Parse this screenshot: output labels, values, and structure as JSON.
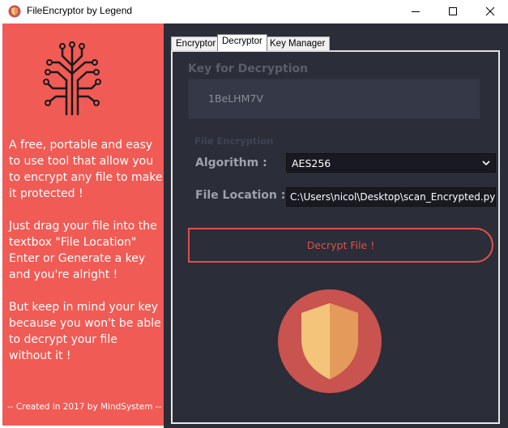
{
  "window": {
    "title": "FileEncryptor by Legend",
    "icons": {
      "app": "shield-app-icon",
      "minimize": "minimize-icon",
      "maximize": "maximize-icon",
      "close": "close-icon"
    }
  },
  "sidebar": {
    "logo_icon": "circuit-tree-icon",
    "paragraphs": [
      "A free, portable and easy to use tool that allow you to encrypt any file to make it protected !",
      "Just drag your file into the textbox \"File Location\" Enter or Generate a key and you're alright !",
      "But keep in mind your key because you won't be able to decrypt your file without it !"
    ],
    "footer": "-- Created in 2017 by MindSystem --"
  },
  "tabs": [
    {
      "label": "Encryptor",
      "active": false
    },
    {
      "label": "Decryptor",
      "active": true
    },
    {
      "label": "Key Manager",
      "active": false
    }
  ],
  "decryptor": {
    "key_title": "Key for Decryption",
    "key_value": "1BeLHM7V",
    "section_title": "File Encryption",
    "algorithm_label": "Algorithm :",
    "algorithm_value": "AES256",
    "location_label": "File Location :",
    "location_value": "C:\\Users\\nicol\\Desktop\\scan_Encrypted.py",
    "decrypt_button": "Decrypt File !",
    "emblem_icon": "shield-icon"
  },
  "colors": {
    "sidebar": "#f15b55",
    "panel": "#2b2d38",
    "accent": "#e0504d",
    "emblem_circle": "#c9534f",
    "shield_light": "#f4c47a",
    "shield_dark": "#e39a5b"
  }
}
